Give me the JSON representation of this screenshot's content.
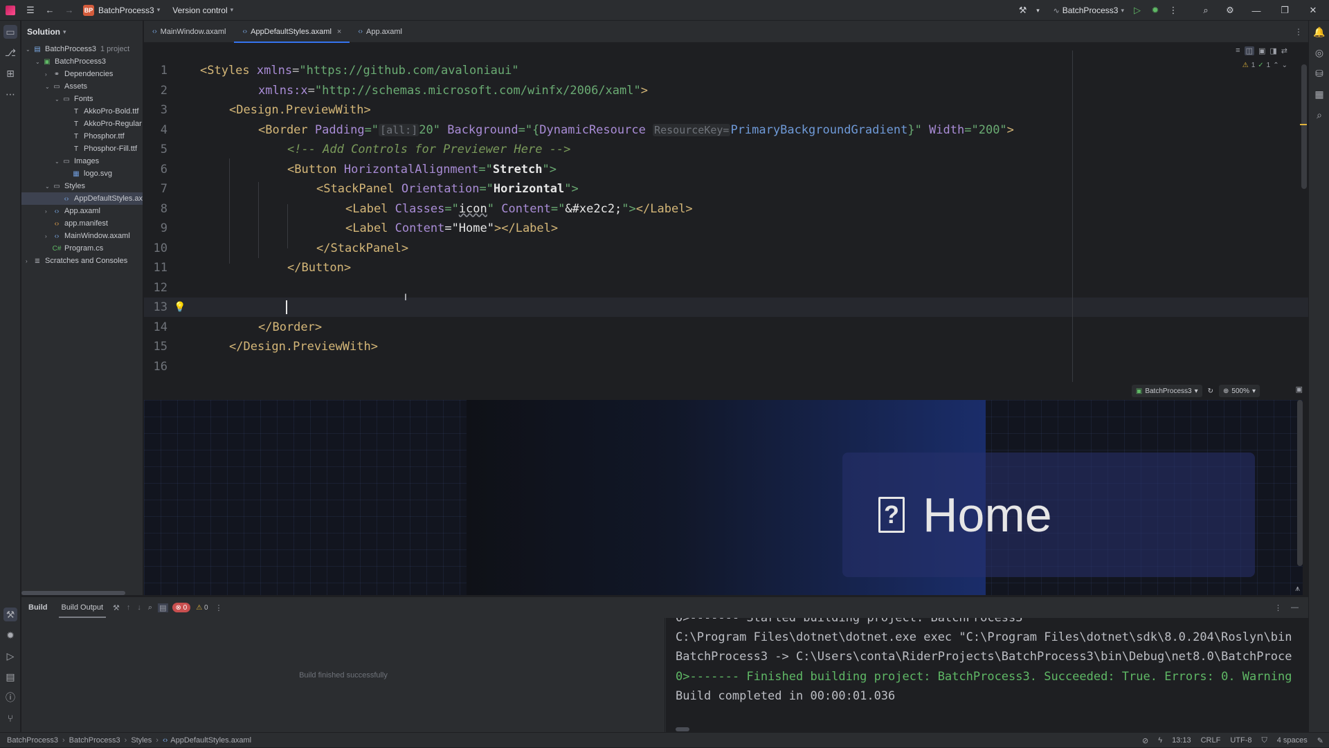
{
  "titlebar": {
    "project_badge": "BP",
    "project_name": "BatchProcess3",
    "version_control": "Version control",
    "run_config": "BatchProcess3"
  },
  "solution": {
    "header": "Solution",
    "tree": [
      {
        "label": "BatchProcess3",
        "suffix": "1 project",
        "level": 0,
        "icon": "solution-icon",
        "expanded": true
      },
      {
        "label": "BatchProcess3",
        "level": 1,
        "icon": "project-icon",
        "expanded": true
      },
      {
        "label": "Dependencies",
        "level": 2,
        "icon": "dependencies-icon",
        "expanded": false
      },
      {
        "label": "Assets",
        "level": 2,
        "icon": "folder-icon",
        "expanded": true
      },
      {
        "label": "Fonts",
        "level": 3,
        "icon": "folder-icon",
        "expanded": true
      },
      {
        "label": "AkkoPro-Bold.ttf",
        "level": 4,
        "icon": "font-file-icon"
      },
      {
        "label": "AkkoPro-Regular",
        "level": 4,
        "icon": "font-file-icon"
      },
      {
        "label": "Phosphor.ttf",
        "level": 4,
        "icon": "font-file-icon"
      },
      {
        "label": "Phosphor-Fill.ttf",
        "level": 4,
        "icon": "font-file-icon"
      },
      {
        "label": "Images",
        "level": 3,
        "icon": "folder-icon",
        "expanded": true
      },
      {
        "label": "logo.svg",
        "level": 4,
        "icon": "image-file-icon"
      },
      {
        "label": "Styles",
        "level": 2,
        "icon": "folder-icon",
        "expanded": true
      },
      {
        "label": "AppDefaultStyles.ax",
        "level": 3,
        "icon": "xaml-file-icon",
        "selected": true
      },
      {
        "label": "App.axaml",
        "level": 2,
        "icon": "xaml-file-icon",
        "expanded": false
      },
      {
        "label": "app.manifest",
        "level": 2,
        "icon": "manifest-file-icon"
      },
      {
        "label": "MainWindow.axaml",
        "level": 2,
        "icon": "xaml-file-icon",
        "expanded": false
      },
      {
        "label": "Program.cs",
        "level": 2,
        "icon": "csharp-file-icon"
      },
      {
        "label": "Scratches and Consoles",
        "level": 0,
        "icon": "scratches-icon",
        "expanded": false
      }
    ]
  },
  "tabs": [
    {
      "label": "MainWindow.axaml",
      "active": false
    },
    {
      "label": "AppDefaultStyles.axaml",
      "active": true
    },
    {
      "label": "App.axaml",
      "active": false
    }
  ],
  "editor": {
    "inspections": {
      "warnings": "1",
      "ok": "1"
    },
    "line_numbers": [
      "1",
      "2",
      "3",
      "4",
      "5",
      "6",
      "7",
      "8",
      "9",
      "10",
      "11",
      "12",
      "13",
      "14",
      "15",
      "16"
    ],
    "code": {
      "l1_tag": "<Styles",
      "l1_attr": "xmlns",
      "l1_val": "\"https://github.com/avaloniaui\"",
      "l2_attr_ns": "xmlns:",
      "l2_attr": "x",
      "l2_val": "\"http://schemas.microsoft.com/winfx/2006/xaml\"",
      "l2_close": ">",
      "l3_tag": "<Design.PreviewWith>",
      "l4_tag": "<Border",
      "l4_padding": "Padding",
      "l4_pad_open": "=\"",
      "l4_pad_hint": "[all:]",
      "l4_pad_val": "20",
      "l4_pad_close": "\"",
      "l4_bg": "Background",
      "l4_bg_open": "=\"{",
      "l4_dyn": "DynamicResource",
      "l4_key_hint": "ResourceKey=",
      "l4_key": "PrimaryBackgroundGradient",
      "l4_bg_close": "}\"",
      "l4_width": "Width",
      "l4_width_val": "=\"200\"",
      "l4_close": ">",
      "l5_comment": "<!-- Add Controls for Previewer Here -->",
      "l6_tag": "<Button",
      "l6_attr": "HorizontalAlignment",
      "l6_eq": "=\"",
      "l6_val": "Stretch",
      "l6_end": "\">",
      "l7_tag": "<StackPanel",
      "l7_attr": "Orientation",
      "l7_eq": "=\"",
      "l7_val": "Horizontal",
      "l7_end": "\">",
      "l8_tag": "<Label",
      "l8_attr": "Classes",
      "l8_eq": "=\"",
      "l8_val": "icon",
      "l8_q": "\"",
      "l8_attr2": "Content",
      "l8_eq2": "=\"",
      "l8_ent": "&#xe2c2;",
      "l8_end": "\">",
      "l8_close": "</Label>",
      "l9_tag": "<Label",
      "l9_attr": "Content",
      "l9_val": "=\"Home\"",
      "l9_gt": ">",
      "l9_close": "</Label>",
      "l10": "</StackPanel>",
      "l11": "</Button>",
      "l14": "</Border>",
      "l15": "</Design.PreviewWith>"
    }
  },
  "preview": {
    "config": "BatchProcess3",
    "zoom": "500%",
    "icon_glyph": "?",
    "button_text": "Home"
  },
  "build": {
    "tab_build": "Build",
    "tab_output": "Build Output",
    "errors": "0",
    "warnings": "0",
    "status": "Build finished successfully",
    "output": [
      "0>------- Started building project: BatchProcess3",
      "C:\\Program Files\\dotnet\\dotnet.exe exec \"C:\\Program Files\\dotnet\\sdk\\8.0.204\\Roslyn\\bin",
      "BatchProcess3 -> C:\\Users\\conta\\RiderProjects\\BatchProcess3\\bin\\Debug\\net8.0\\BatchProce",
      "0>------- Finished building project: BatchProcess3. Succeeded: True. Errors: 0. Warning",
      "Build completed in 00:00:01.036"
    ]
  },
  "statusbar": {
    "breadcrumbs": [
      "BatchProcess3",
      "BatchProcess3",
      "Styles",
      "AppDefaultStyles.axaml"
    ],
    "position": "13:13",
    "line_ending": "CRLF",
    "encoding": "UTF-8",
    "indent": "4 spaces"
  }
}
